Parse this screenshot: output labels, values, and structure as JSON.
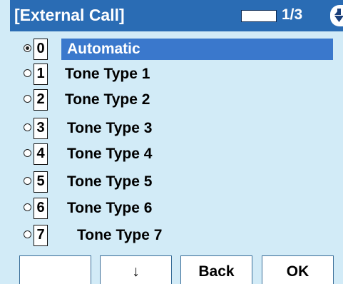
{
  "header": {
    "title": "[External Call]",
    "page_indicator": "1/3"
  },
  "list": {
    "items": [
      {
        "key": "0",
        "label": "Automatic",
        "selected": true
      },
      {
        "key": "1",
        "label": "Tone Type 1",
        "selected": false
      },
      {
        "key": "2",
        "label": "Tone Type 2",
        "selected": false
      },
      {
        "key": "3",
        "label": "Tone Type 3",
        "selected": false
      },
      {
        "key": "4",
        "label": "Tone Type 4",
        "selected": false
      },
      {
        "key": "5",
        "label": "Tone Type 5",
        "selected": false
      },
      {
        "key": "6",
        "label": "Tone Type 6",
        "selected": false
      },
      {
        "key": "7",
        "label": "Tone Type 7",
        "selected": false
      }
    ]
  },
  "softkeys": [
    "",
    "↓",
    "Back",
    "OK"
  ],
  "colors": {
    "title_bar": "#2a6cb4",
    "background": "#d2ebf7",
    "selection": "#3a78cc"
  }
}
